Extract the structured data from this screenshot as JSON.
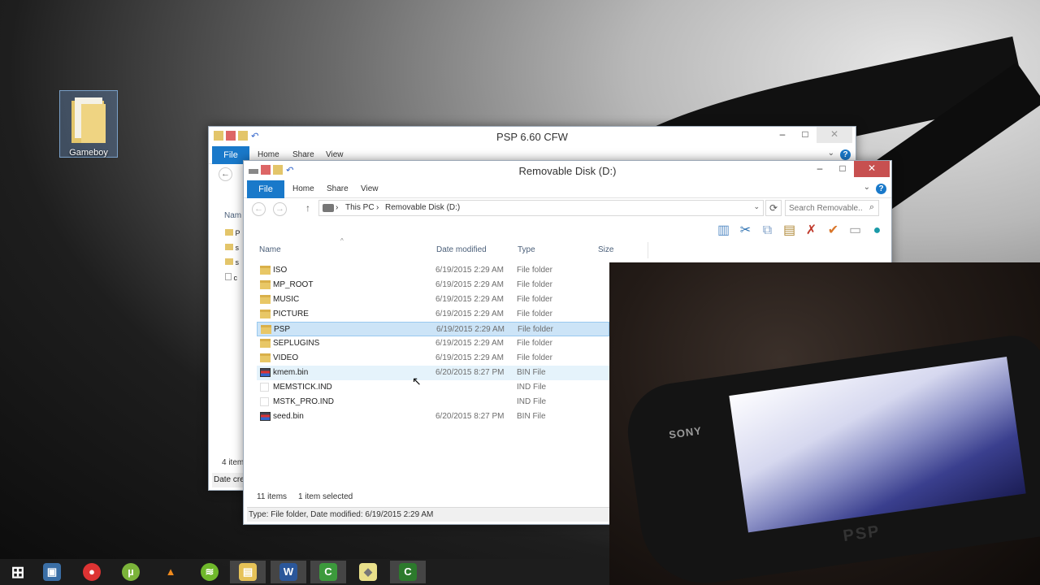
{
  "desktop": {
    "icon_label": "Gameboy"
  },
  "back_window": {
    "title": "PSP 6.60 CFW",
    "ribbon": {
      "file": "File",
      "home": "Home",
      "share": "Share",
      "view": "View"
    },
    "nav_letter": "Nam",
    "sidebar_items": [
      "P",
      "s",
      "s",
      "c"
    ],
    "status": "4 item",
    "status_detail": "Date cre"
  },
  "window": {
    "title": "Removable Disk (D:)",
    "ribbon": {
      "file": "File",
      "home": "Home",
      "share": "Share",
      "view": "View"
    },
    "breadcrumb": [
      "This PC",
      "Removable Disk (D:)"
    ],
    "search_placeholder": "Search Removable...",
    "columns": {
      "name": "Name",
      "date": "Date modified",
      "type": "Type",
      "size": "Size"
    },
    "files": [
      {
        "name": "ISO",
        "date": "6/19/2015 2:29 AM",
        "type": "File folder",
        "icon": "folder-icon"
      },
      {
        "name": "MP_ROOT",
        "date": "6/19/2015 2:29 AM",
        "type": "File folder",
        "icon": "folder-icon"
      },
      {
        "name": "MUSIC",
        "date": "6/19/2015 2:29 AM",
        "type": "File folder",
        "icon": "folder-icon"
      },
      {
        "name": "PICTURE",
        "date": "6/19/2015 2:29 AM",
        "type": "File folder",
        "icon": "folder-icon"
      },
      {
        "name": "PSP",
        "date": "6/19/2015 2:29 AM",
        "type": "File folder",
        "icon": "folder-icon",
        "selected": true
      },
      {
        "name": "SEPLUGINS",
        "date": "6/19/2015 2:29 AM",
        "type": "File folder",
        "icon": "folder-icon"
      },
      {
        "name": "VIDEO",
        "date": "6/19/2015 2:29 AM",
        "type": "File folder",
        "icon": "folder-icon"
      },
      {
        "name": "kmem.bin",
        "date": "6/20/2015 8:27 PM",
        "type": "BIN File",
        "icon": "bin-file-icon",
        "hovered": true
      },
      {
        "name": "MEMSTICK.IND",
        "date": "",
        "type": "IND File",
        "icon": "blank-file-icon"
      },
      {
        "name": "MSTK_PRO.IND",
        "date": "",
        "type": "IND File",
        "icon": "blank-file-icon"
      },
      {
        "name": "seed.bin",
        "date": "6/20/2015 8:27 PM",
        "type": "BIN File",
        "icon": "bin-file-icon"
      }
    ],
    "item_count": "11 items",
    "selection": "1 item selected",
    "status_bar": "Type: File folder, Date modified: 6/19/2015 2:29 AM",
    "toolbar_icons": [
      "layout-icon",
      "cut-icon",
      "copy-icon",
      "paste-icon",
      "delete-icon",
      "check-icon",
      "rename-icon",
      "globe-icon"
    ]
  },
  "webcam": {
    "brand": "SONY",
    "device_label": "PSP"
  },
  "taskbar": {
    "items": [
      "start-icon",
      "computer-icon",
      "chrome-icon",
      "utorrent-icon",
      "vlc-icon",
      "spotify-icon",
      "file-explorer-icon",
      "word-icon",
      "camtasia-icon",
      "folder-icon",
      "camtasia-recorder-icon"
    ],
    "active": [
      "file-explorer-icon",
      "word-icon",
      "camtasia-icon",
      "camtasia-recorder-icon"
    ]
  },
  "colors": {
    "accent": "#1979ca",
    "selection": "#cce4f7",
    "close": "#c75050"
  }
}
